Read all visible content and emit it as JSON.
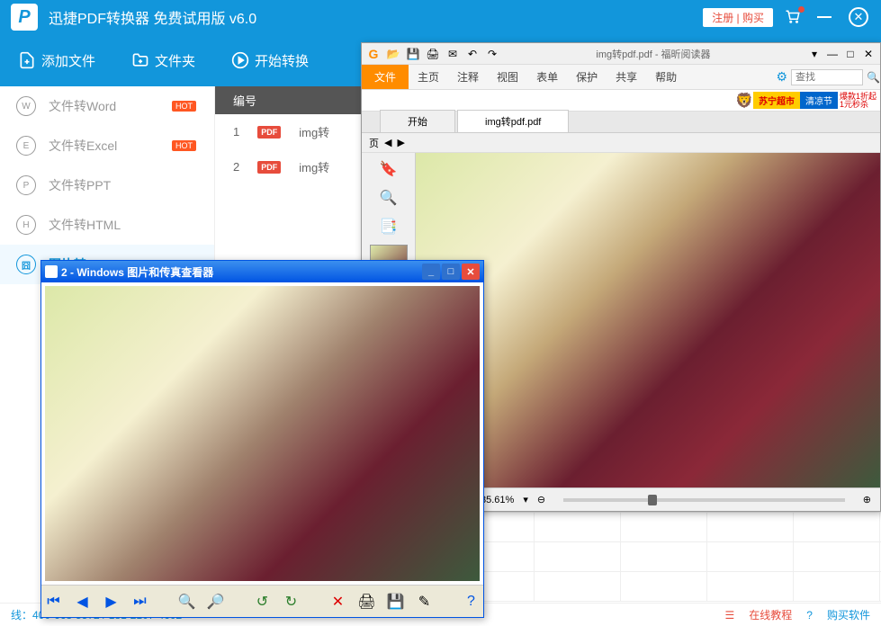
{
  "main": {
    "title": "迅捷PDF转换器 免费试用版 v6.0",
    "register": "注册 | 购买",
    "toolbar": {
      "add_file": "添加文件",
      "add_folder": "文件夹",
      "start_convert": "开始转换"
    },
    "sidebar": [
      {
        "icon": "W",
        "label": "文件转Word",
        "hot": true
      },
      {
        "icon": "E",
        "label": "文件转Excel",
        "hot": true
      },
      {
        "icon": "P",
        "label": "文件转PPT",
        "hot": false
      },
      {
        "icon": "H",
        "label": "文件转HTML",
        "hot": false
      },
      {
        "icon": "囧",
        "label": "图片转PDF",
        "hot": false,
        "active": true
      }
    ],
    "file_header": "编号",
    "files": [
      {
        "num": "1",
        "name": "img转"
      },
      {
        "num": "2",
        "name": "img转"
      }
    ],
    "status": {
      "phone": "线：400-668-5572 / 181-2107-4602",
      "tutorial": "在线教程",
      "buy": "购买软件"
    }
  },
  "photo_viewer": {
    "title": "2 - Windows 图片和传真查看器"
  },
  "foxit": {
    "title": "img转pdf.pdf - 福昕阅读器",
    "file_menu": "文件",
    "menus": [
      "主页",
      "注释",
      "视图",
      "表单",
      "保护",
      "共享",
      "帮助"
    ],
    "search_placeholder": "查找",
    "ad1": "苏宁超市",
    "ad2": "清凉节",
    "ad_text1": "爆款1折起",
    "ad_text2": "1元秒杀",
    "tabs": [
      "开始",
      "img转pdf.pdf"
    ],
    "page_label": "页",
    "zoom": "85.61%"
  }
}
